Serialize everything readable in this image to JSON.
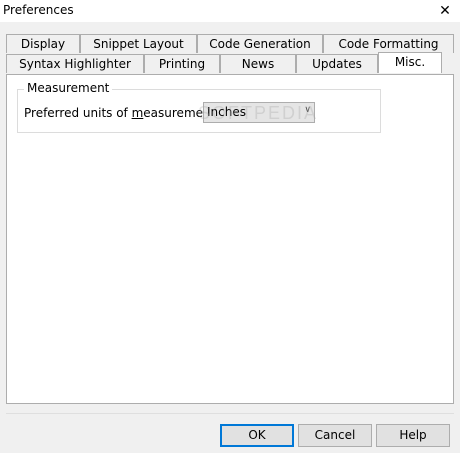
{
  "window": {
    "title": "Preferences",
    "close_glyph": "✕"
  },
  "tabs_back": [
    "Display",
    "Snippet Layout",
    "Code Generation",
    "Code Formatting"
  ],
  "tabs_front": [
    "Syntax Highlighter",
    "Printing",
    "News",
    "Updates",
    "Misc."
  ],
  "active_tab": "Misc.",
  "measurement": {
    "group_label": "Measurement",
    "units_label_prefix": "Preferred units of ",
    "units_label_mnemonic": "m",
    "units_label_suffix": "easurement:",
    "units_value": "Inches"
  },
  "watermark": "SOFTPEDIA",
  "buttons": {
    "ok": "OK",
    "cancel": "Cancel",
    "help": "Help"
  },
  "colors": {
    "default_button_border": "#0078d7",
    "panel_bg": "#ffffff",
    "window_bg": "#f0f0f0"
  }
}
